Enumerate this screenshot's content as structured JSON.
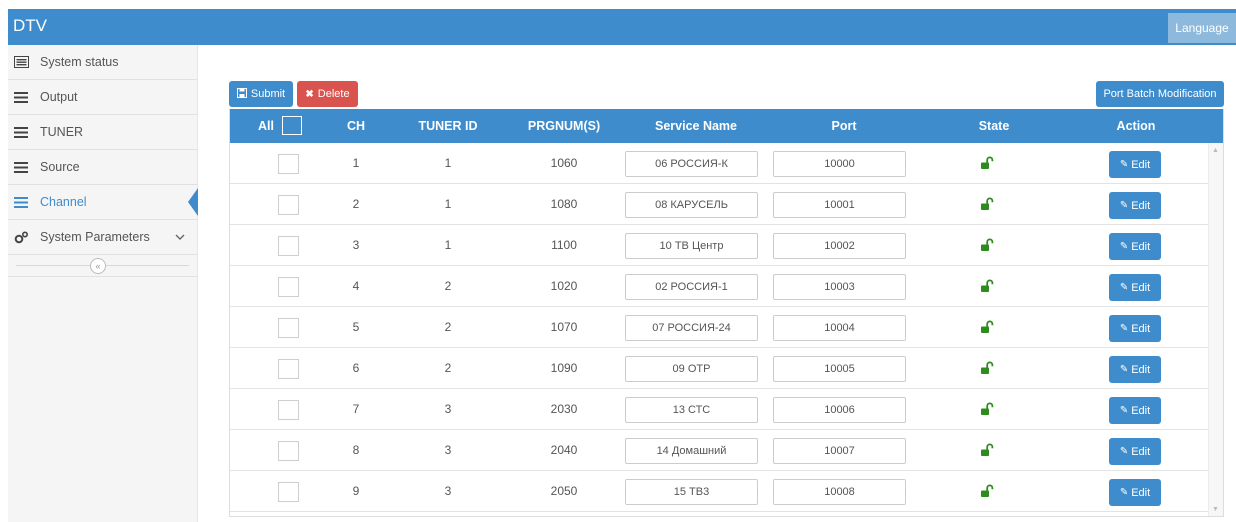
{
  "app": {
    "title": "DTV",
    "language_label": "Language"
  },
  "sidebar": {
    "items": [
      {
        "label": "System status",
        "icon": "list-icon"
      },
      {
        "label": "Output",
        "icon": "menu-icon"
      },
      {
        "label": "TUNER",
        "icon": "menu-icon"
      },
      {
        "label": "Source",
        "icon": "menu-icon"
      },
      {
        "label": "Channel",
        "icon": "menu-icon",
        "active": true
      },
      {
        "label": "System Parameters",
        "icon": "gears-icon",
        "expandable": true
      }
    ],
    "collapse_icon": "«"
  },
  "toolbar": {
    "submit_label": "Submit",
    "delete_label": "Delete",
    "batch_label": "Port Batch Modification"
  },
  "table": {
    "headers": {
      "all": "All",
      "ch": "CH",
      "tuner_id": "TUNER ID",
      "prgnum": "PRGNUM(S)",
      "service_name": "Service Name",
      "port": "Port",
      "state": "State",
      "action": "Action"
    },
    "edit_label": "Edit",
    "rows": [
      {
        "ch": "1",
        "tuner_id": "1",
        "prgnum": "1060",
        "service_name": "06 РОССИЯ-К",
        "port": "10000"
      },
      {
        "ch": "2",
        "tuner_id": "1",
        "prgnum": "1080",
        "service_name": "08 КАРУСЕЛЬ",
        "port": "10001"
      },
      {
        "ch": "3",
        "tuner_id": "1",
        "prgnum": "1100",
        "service_name": "10 ТВ Центр",
        "port": "10002"
      },
      {
        "ch": "4",
        "tuner_id": "2",
        "prgnum": "1020",
        "service_name": "02 РОССИЯ-1",
        "port": "10003"
      },
      {
        "ch": "5",
        "tuner_id": "2",
        "prgnum": "1070",
        "service_name": "07 РОССИЯ-24",
        "port": "10004"
      },
      {
        "ch": "6",
        "tuner_id": "2",
        "prgnum": "1090",
        "service_name": "09 ОТР",
        "port": "10005"
      },
      {
        "ch": "7",
        "tuner_id": "3",
        "prgnum": "2030",
        "service_name": "13 СТС",
        "port": "10006"
      },
      {
        "ch": "8",
        "tuner_id": "3",
        "prgnum": "2040",
        "service_name": "14 Домашний",
        "port": "10007"
      },
      {
        "ch": "9",
        "tuner_id": "3",
        "prgnum": "2050",
        "service_name": "15 ТВ3",
        "port": "10008"
      }
    ]
  },
  "colors": {
    "primary": "#3f8ccc",
    "danger": "#d9534f",
    "lock_open": "#2e8b1e"
  }
}
